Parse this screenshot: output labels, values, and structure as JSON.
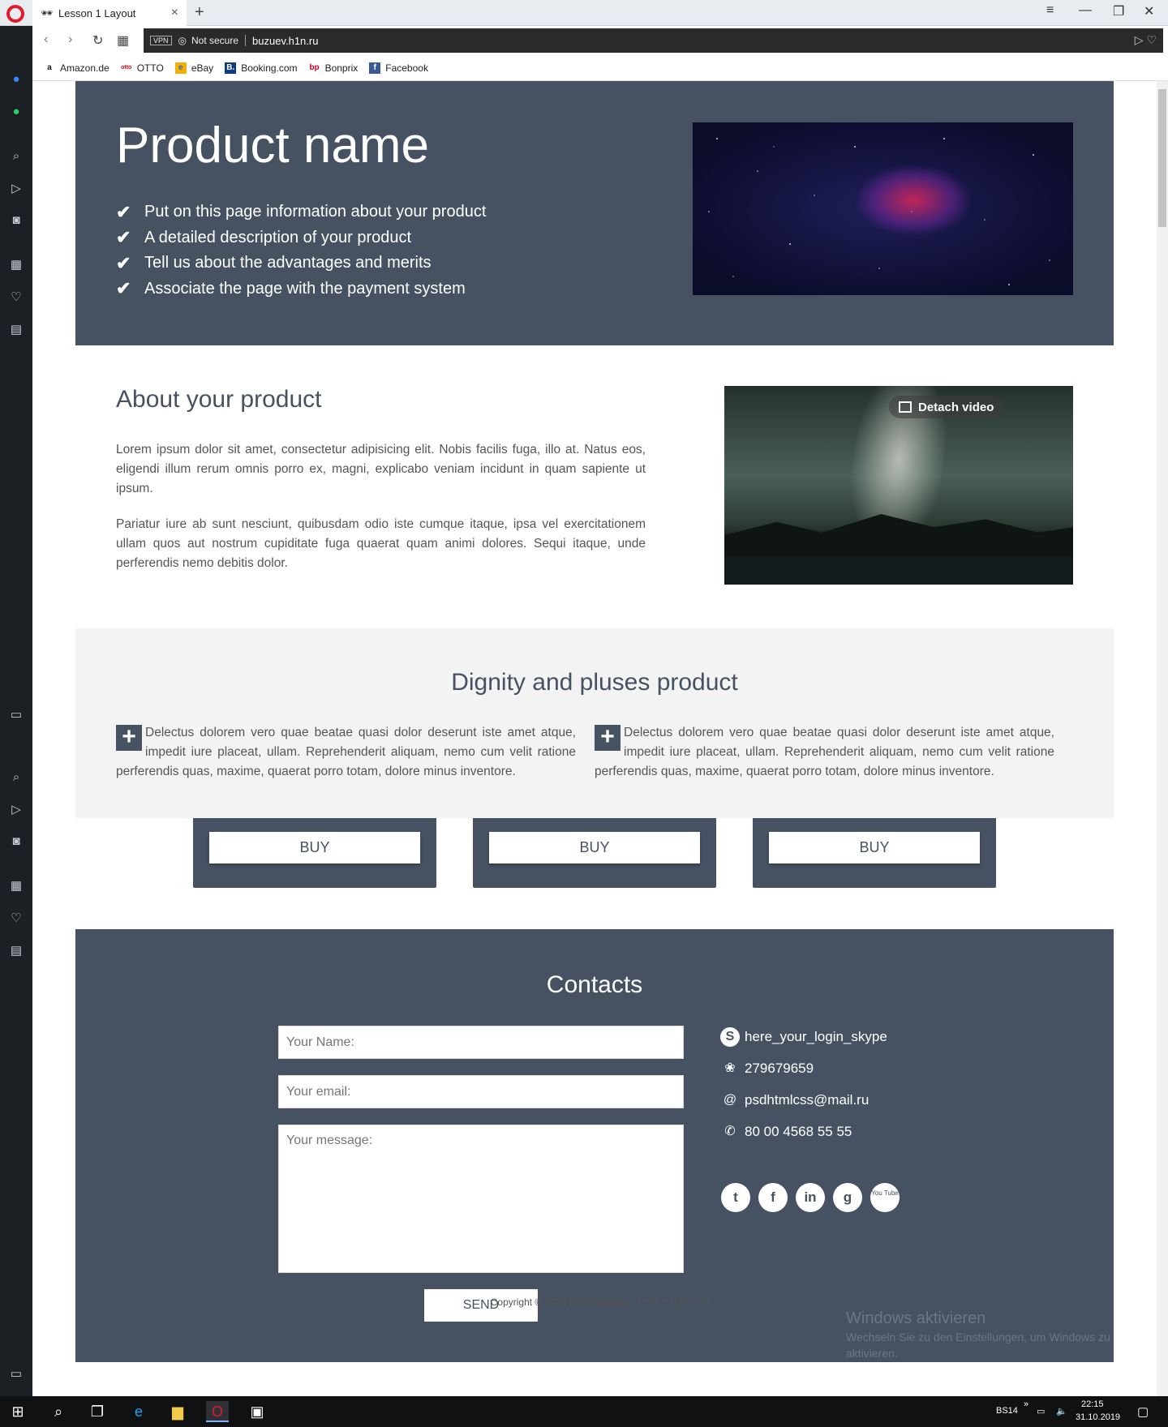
{
  "browser": {
    "tab_title": "Lesson 1 Layout",
    "tab_icon": "incognito-icon",
    "new_tab": "+",
    "vpn_label": "VPN",
    "security_label": "Not secure",
    "url": "buzuev.h1n.ru",
    "bookmarks": [
      {
        "label": "Amazon.de",
        "icon": "a",
        "color": "#111111"
      },
      {
        "label": "OTTO",
        "icon": "otto",
        "color": "#e2001a"
      },
      {
        "label": "eBay",
        "icon": "e",
        "color": "#3267c1"
      },
      {
        "label": "Booking.com",
        "icon": "B.",
        "color": "#0d3d87"
      },
      {
        "label": "Bonprix",
        "icon": "b",
        "color": "#d6002a"
      },
      {
        "label": "Facebook",
        "icon": "f",
        "color": "#3b5998"
      }
    ]
  },
  "hero": {
    "title": "Product name",
    "features": [
      "Put on this page information about your product",
      "A detailed description of your product",
      "Tell us about the advantages and merits",
      "Associate the page with the payment system"
    ],
    "check_glyph": "✔"
  },
  "about": {
    "title": "About your product",
    "paragraph1": "Lorem ipsum dolor sit amet, consectetur adipisicing elit. Nobis facilis fuga, illo at. Natus eos, eligendi illum rerum omnis porro ex, magni, explicabo veniam incidunt in quam sapiente ut ipsum.",
    "paragraph2": "Pariatur iure ab sunt nesciunt, quibusdam odio iste cumque itaque, ipsa vel exercitationem ullam quos aut nostrum cupiditate fuga quaerat quam animi dolores. Sequi itaque, unde perferendis nemo debitis dolor.",
    "video_overlay": "Detach video"
  },
  "dignity": {
    "title": "Dignity and pluses product",
    "plus_glyph": "+",
    "items": [
      "Delectus dolorem vero quae beatae quasi dolor deserunt iste amet atque, impedit iure placeat, ullam. Reprehenderit aliquam, nemo cum velit ratione perferendis quas, maxime, quaerat porro totam, dolore minus inventore.",
      "Delectus dolorem vero quae beatae quasi dolor deserunt iste amet atque, impedit iure placeat, ullam. Reprehenderit aliquam, nemo cum velit ratione perferendis quas, maxime, quaerat porro totam, dolore minus inventore."
    ]
  },
  "pricing": {
    "buy_labels": [
      "BUY",
      "BUY",
      "BUY"
    ]
  },
  "contacts": {
    "title": "Contacts",
    "name_placeholder": "Your Name:",
    "email_placeholder": "Your email:",
    "message_placeholder": "Your message:",
    "send_label": "SEND",
    "skype": "here_your_login_skype",
    "icq": "279679659",
    "email": "psdhtmlcss@mail.ru",
    "phone": "80 00 4568 55 55",
    "social": [
      {
        "name": "twitter",
        "glyph": "t"
      },
      {
        "name": "facebook",
        "glyph": "f"
      },
      {
        "name": "linkedin",
        "glyph": "in"
      },
      {
        "name": "google",
        "glyph": "g"
      },
      {
        "name": "youtube",
        "glyph": "You Tube"
      }
    ]
  },
  "footer": {
    "copyright": "Copyright © 2014 Product name · PSD HTML CSS"
  },
  "watermark": {
    "title": "Windows aktivieren",
    "line1": "Wechseln Sie zu den Einstellungen, um Windows zu",
    "line2": "aktivieren."
  },
  "taskbar": {
    "language": "BS14",
    "time": "22:15",
    "date": "31.10.2019"
  }
}
